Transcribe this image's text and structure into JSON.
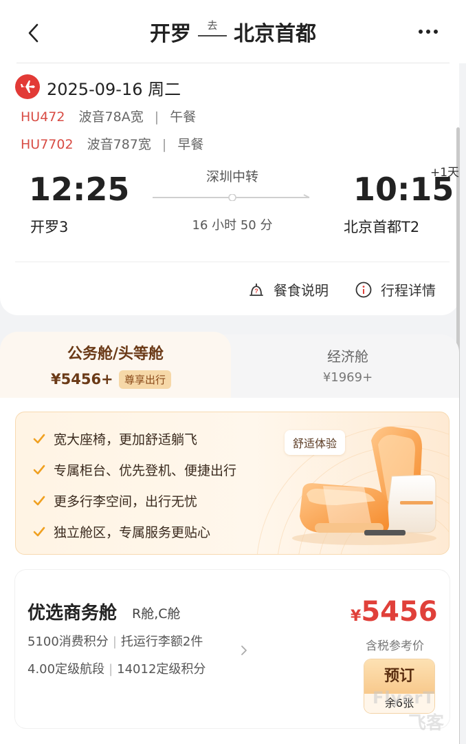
{
  "header": {
    "origin": "开罗",
    "direction": "去",
    "destination": "北京首都"
  },
  "flight": {
    "date": "2025-09-16 周二",
    "segments": [
      {
        "flight_no": "HU472",
        "aircraft": "波音78A宽",
        "meal": "午餐"
      },
      {
        "flight_no": "HU7702",
        "aircraft": "波音787宽",
        "meal": "早餐"
      }
    ],
    "departure": {
      "time": "12:25",
      "airport": "开罗3"
    },
    "arrival": {
      "time": "10:15",
      "airport": "北京首都T2",
      "day_offset": "+1天"
    },
    "transit": "深圳中转",
    "duration": "16 小时 50 分",
    "links": {
      "meal": "餐食说明",
      "itinerary": "行程详情"
    }
  },
  "cabins": {
    "active": {
      "title": "公务舱/头等舱",
      "price": "¥5456+",
      "badge": "尊享出行"
    },
    "economy": {
      "title": "经济舱",
      "price": "¥1969+"
    }
  },
  "benefits": {
    "items": [
      "宽大座椅，更加舒适躺飞",
      "专属柜台、优先登机、便捷出行",
      "更多行李空间，出行无忧",
      "独立舱区，专属服务更贴心"
    ],
    "tag": "舒适体验"
  },
  "product": {
    "title": "优选商务舱",
    "classes": "R舱,C舱",
    "points": "5100消费积分",
    "baggage": "托运行李额2件",
    "segments": "4.00定级航段",
    "tier_points": "14012定级积分",
    "currency": "¥",
    "price": "5456",
    "price_note": "含税参考价",
    "book_label": "预订",
    "remaining": "余6张"
  },
  "watermark": {
    "line1": "FlyerT",
    "line2": "飞客"
  },
  "colors": {
    "accent_red": "#e0403a",
    "gold": "#f8c98c",
    "brown": "#6b3a17"
  },
  "icons": [
    "back-arrow-icon",
    "more-dots-icon",
    "airline-logo-icon",
    "meal-icon",
    "info-icon",
    "check-icon",
    "chevron-right-icon"
  ]
}
